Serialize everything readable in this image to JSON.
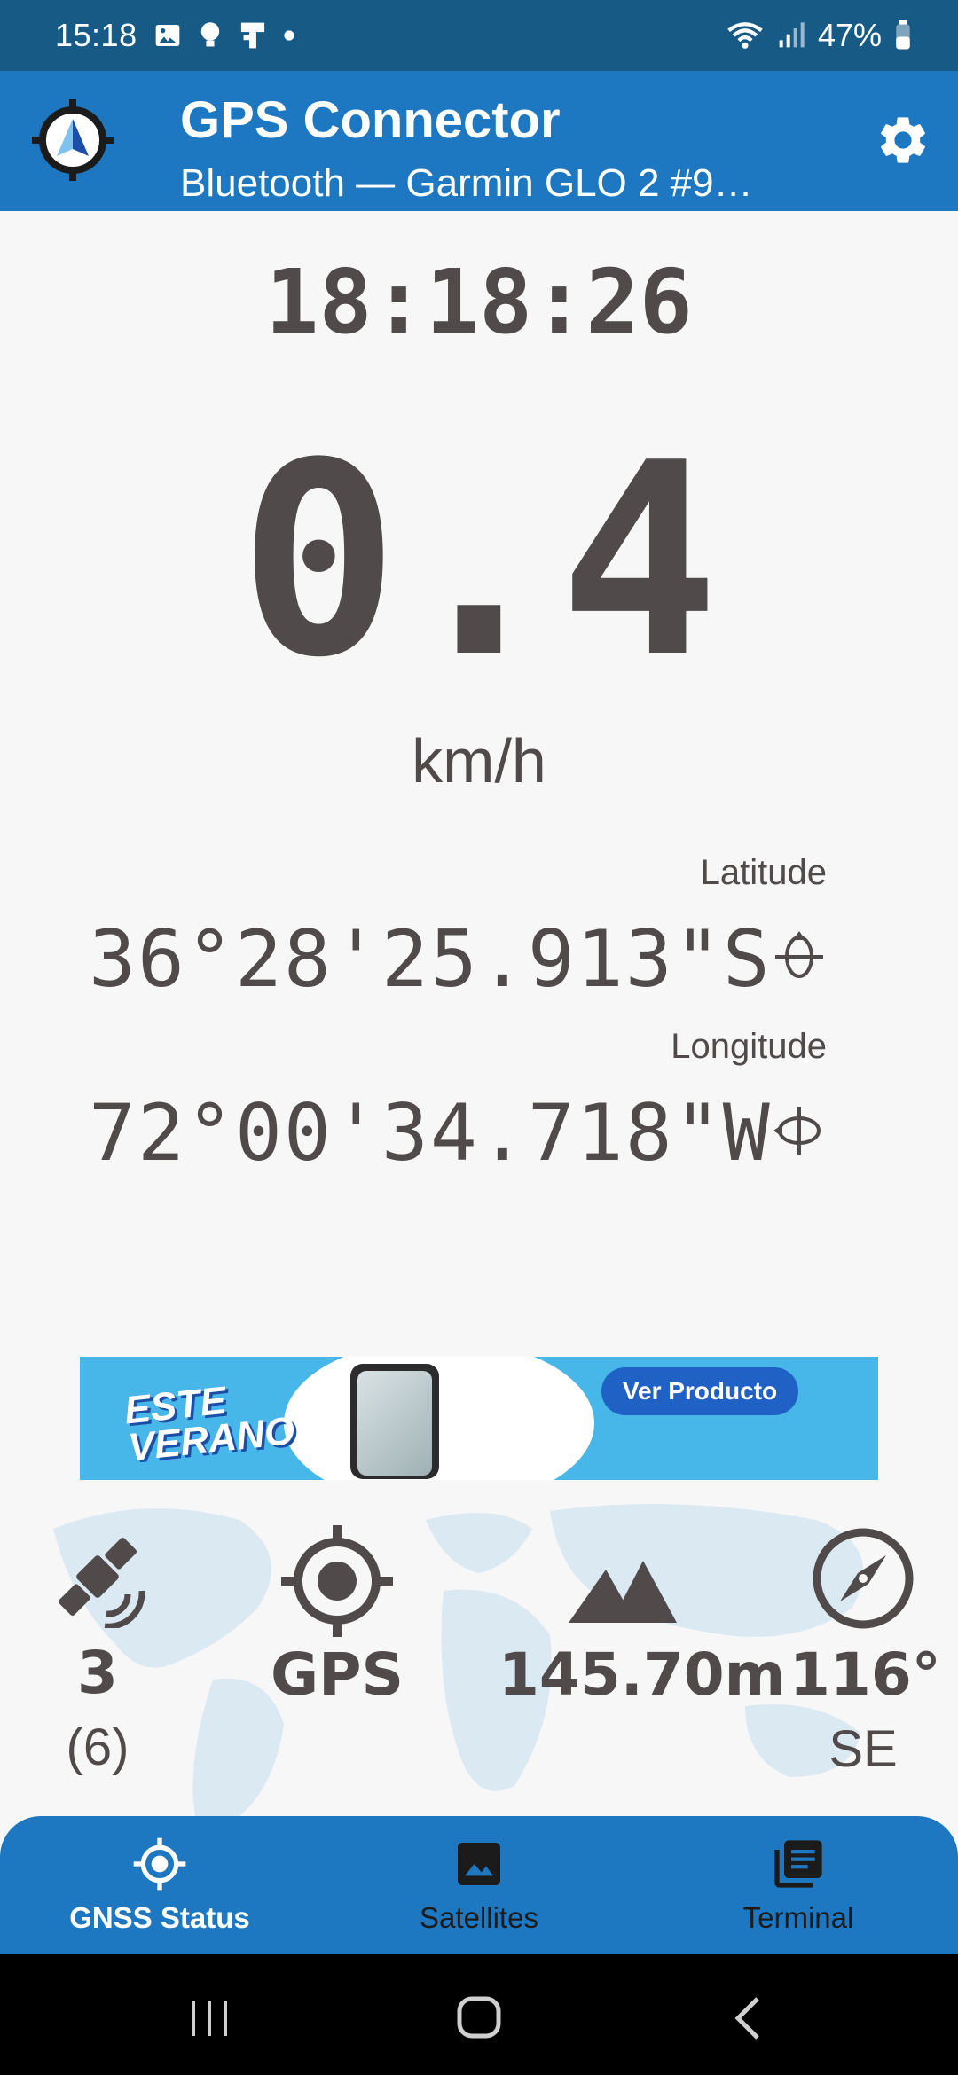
{
  "status_bar": {
    "time": "15:18",
    "battery": "47%",
    "icons": [
      "image-icon",
      "bulb-icon",
      "connector-icon",
      "dot-icon",
      "wifi-icon",
      "signal-icon",
      "battery-icon"
    ]
  },
  "app_bar": {
    "title": "GPS Connector",
    "subtitle": "Bluetooth — Garmin GLO 2 #9…",
    "logo_icon": "gps-compass-logo-icon",
    "settings_icon": "gear-icon"
  },
  "readout": {
    "clock": "18:18:26",
    "speed": "0.4",
    "speed_unit": "km/h",
    "latitude_label": "Latitude",
    "latitude": "36°28'25.913\"S",
    "longitude_label": "Longitude",
    "longitude": "72°00'34.718\"W"
  },
  "ad": {
    "headline": "ESTE VERANO",
    "button": "Ver Producto"
  },
  "stats": {
    "satellites": "3",
    "satellites_total": "(6)",
    "fix_type": "GPS",
    "altitude": "145.70m",
    "bearing": "116°",
    "bearing_dir": "SE"
  },
  "bottom_nav": {
    "items": [
      {
        "label": "GNSS Status",
        "active": true
      },
      {
        "label": "Satellites",
        "active": false
      },
      {
        "label": "Terminal",
        "active": false
      }
    ]
  },
  "colors": {
    "status_bar": "#175a85",
    "primary": "#1d78c1",
    "text": "#514a4a",
    "background": "#f7f7f7"
  }
}
